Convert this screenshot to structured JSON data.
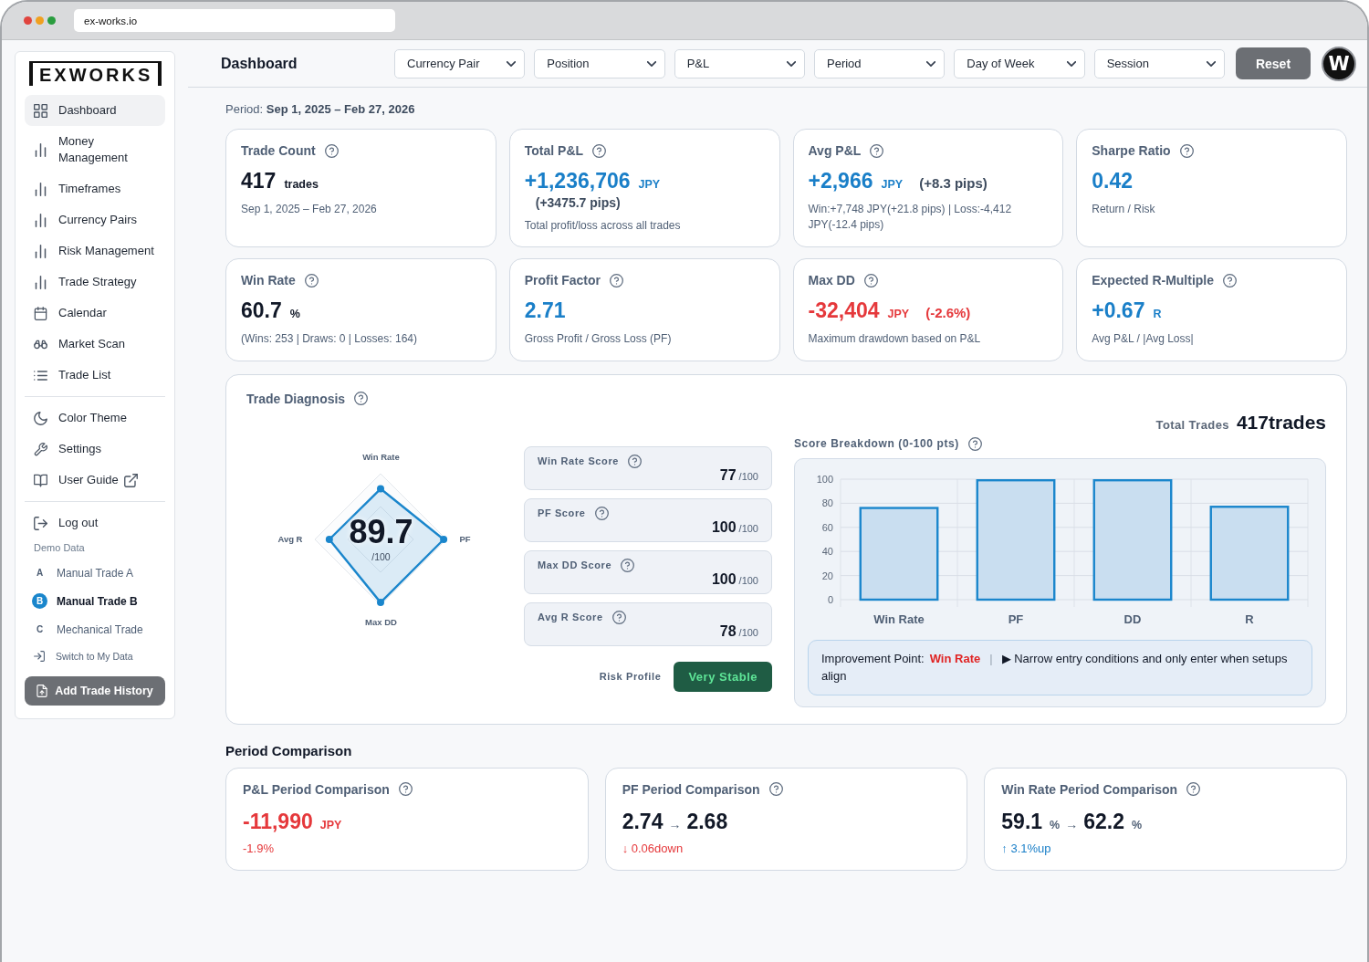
{
  "browser": {
    "address": "ex-works.io"
  },
  "sidebar": {
    "logo": "EXWORKS",
    "nav": [
      {
        "label": "Dashboard",
        "selected": true
      },
      {
        "label": "Money Management",
        "selected": false
      },
      {
        "label": "Timeframes",
        "selected": false
      },
      {
        "label": "Currency Pairs",
        "selected": false
      },
      {
        "label": "Risk Management",
        "selected": false
      },
      {
        "label": "Trade Strategy",
        "selected": false
      },
      {
        "label": "Calendar",
        "selected": false
      },
      {
        "label": "Market Scan",
        "selected": false
      },
      {
        "label": "Trade List",
        "selected": false
      }
    ],
    "utility_nav": [
      {
        "label": "Color Theme",
        "selected": false,
        "external": false
      },
      {
        "label": "Settings",
        "selected": false,
        "external": false
      },
      {
        "label": "User Guide",
        "selected": false,
        "external": true
      }
    ],
    "logout": "Log out",
    "demo_data": {
      "heading": "Demo Data",
      "items": [
        {
          "marker": "A",
          "label": "Manual Trade A",
          "selected": false
        },
        {
          "marker": "B",
          "label": "Manual Trade B",
          "selected": true
        },
        {
          "marker": "C",
          "label": "Mechanical Trade",
          "selected": false
        }
      ],
      "switch_link": "Switch to My Data"
    },
    "add_button": "Add Trade History"
  },
  "header": {
    "title": "Dashboard",
    "filters": [
      "Currency Pair",
      "Position",
      "P&L",
      "Period",
      "Day of Week",
      "Session"
    ],
    "reset_button": "Reset",
    "brand_mark": "W"
  },
  "period": "Period: **Sep 1, 2025 – Feb 27, 2026**",
  "stats": [
    {
      "title": "Trade Count",
      "value": "417",
      "unit": "trades",
      "color": "#111827",
      "note": "Sep 1, 2025 – Feb 27, 2026"
    },
    {
      "title": "Total P&L",
      "value": "+1,236,706",
      "unit": "JPY",
      "subvalue": "(+3475.7 pips)",
      "color": "#1a7fc8",
      "note": "Total profit/loss across all trades"
    },
    {
      "title": "Avg P&L",
      "value": "+2,966",
      "unit": "JPY",
      "extra": {
        "text": "(+8.3 pips)",
        "color": "#3d4b5e"
      },
      "color": "#1a7fc8",
      "note": "Win:+7,748 JPY(+21.8 pips) | Loss:-4,412 JPY(-12.4 pips)"
    },
    {
      "title": "Sharpe Ratio",
      "value": "0.42",
      "color": "#1a7fc8",
      "note": "Return / Risk"
    },
    {
      "title": "Win Rate",
      "value": "60.7",
      "unit": "%",
      "color": "#111827",
      "note": "(Wins: 253 | Draws: 0 | Losses: 164)"
    },
    {
      "title": "Profit Factor",
      "value": "2.71",
      "color": "#1a7fc8",
      "note": "Gross Profit / Gross Loss (PF)"
    },
    {
      "title": "Max DD",
      "value": "-32,404",
      "unit": "JPY",
      "extra": {
        "text": "(-2.6%)",
        "color": "#e5383b"
      },
      "color": "#e5383b",
      "note": "Maximum drawdown based on P&L"
    },
    {
      "title": "Expected R-Multiple",
      "value": "+0.67",
      "unit": "R",
      "color": "#1a7fc8",
      "note": "Avg P&L / |Avg Loss|"
    }
  ],
  "diagnosis": {
    "title": "Trade Diagnosis",
    "radar": {
      "axes": [
        "Win Rate",
        "PF",
        "Max DD",
        "Avg R"
      ],
      "score": "89.7",
      "max": "/100"
    },
    "scores": [
      {
        "label": "Win Rate Score",
        "value": "77",
        "max": "/100"
      },
      {
        "label": "PF Score",
        "value": "100",
        "max": "/100"
      },
      {
        "label": "Max DD Score",
        "value": "100",
        "max": "/100"
      },
      {
        "label": "Avg R Score",
        "value": "78",
        "max": "/100"
      }
    ],
    "risk_profile": {
      "label": "Risk Profile",
      "value": "Very Stable"
    },
    "total_trades": {
      "label": "Total Trades",
      "value": "417trades"
    },
    "breakdown": {
      "chart_data": {
        "type": "bar",
        "title": "Score Breakdown (0-100 pts)",
        "categories": [
          "Win Rate",
          "PF",
          "DD",
          "R"
        ],
        "values": [
          77,
          100,
          100,
          78
        ],
        "ylim": [
          0,
          100
        ],
        "yticks": [
          0,
          20,
          40,
          60,
          80,
          100
        ],
        "grid": true
      },
      "improvement": {
        "label": "Improvement Point:",
        "focus": "Win Rate",
        "separator": "|",
        "advice": "▶ Narrow entry conditions and only enter when setups align"
      }
    }
  },
  "period_comparison": {
    "title": "Period Comparison",
    "cards": [
      {
        "kind": "single",
        "title": "P&L Period Comparison",
        "value": "-11,990",
        "unit": "JPY",
        "change": "-1.9%",
        "color": "#e5383b"
      },
      {
        "kind": "transition",
        "title": "PF Period Comparison",
        "from": "2.74",
        "arrow": "→",
        "to": "2.68",
        "change": "↓ 0.06down",
        "color": "#e5383b"
      },
      {
        "kind": "transition",
        "title": "Win Rate Period Comparison",
        "from": "59.1",
        "from_unit": "%",
        "arrow": "→",
        "to": "62.2",
        "to_unit": "%",
        "change": "↑ 3.1%up",
        "color": "#1a7fc8"
      }
    ]
  }
}
